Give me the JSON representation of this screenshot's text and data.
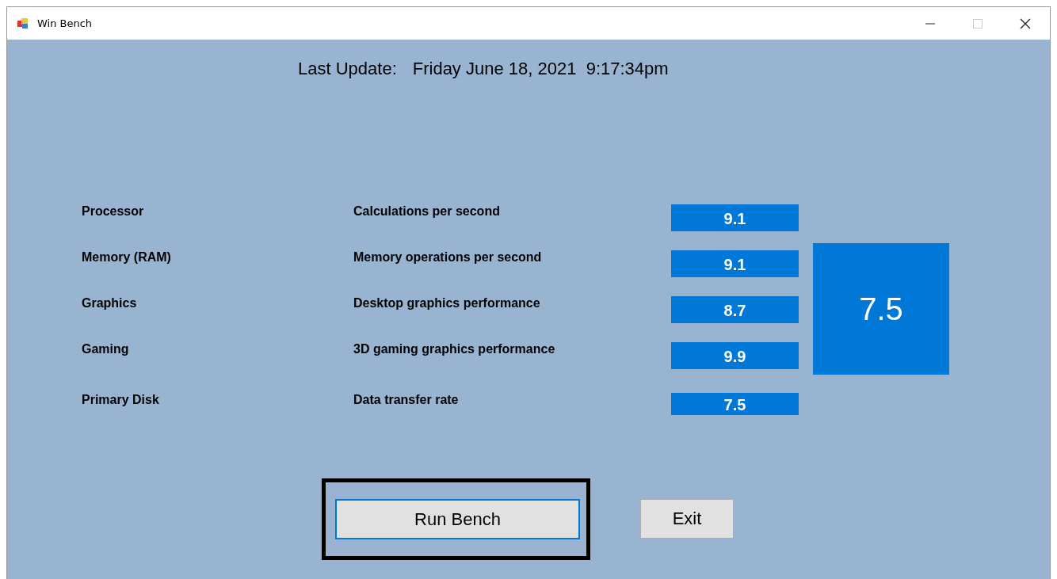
{
  "window": {
    "title": "Win Bench"
  },
  "last_update": {
    "label": "Last Update:",
    "value": "Friday June 18, 2021  9:17:34pm"
  },
  "rows": [
    {
      "component": "Processor",
      "description": "Calculations per second",
      "score": "9.1"
    },
    {
      "component": "Memory (RAM)",
      "description": "Memory operations per second",
      "score": "9.1"
    },
    {
      "component": "Graphics",
      "description": "Desktop graphics performance",
      "score": "8.7"
    },
    {
      "component": "Gaming",
      "description": "3D gaming graphics performance",
      "score": "9.9"
    },
    {
      "component": "Primary Disk",
      "description": "Data transfer rate",
      "score": "7.5"
    }
  ],
  "overall_score": "7.5",
  "buttons": [
    {
      "label": "Run Bench",
      "focused": true,
      "highlighted": true
    },
    {
      "label": "Exit",
      "focused": false,
      "highlighted": false
    }
  ]
}
